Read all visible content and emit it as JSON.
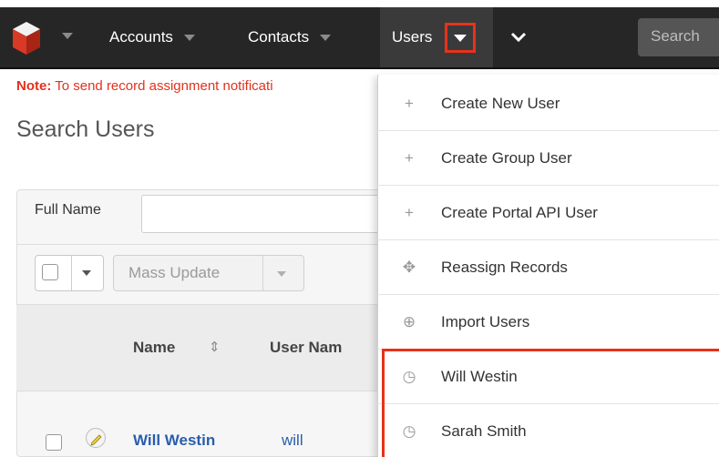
{
  "nav": {
    "items": [
      {
        "label": "Accounts"
      },
      {
        "label": "Contacts"
      },
      {
        "label": "Users"
      }
    ],
    "search_placeholder": "Search"
  },
  "note": {
    "prefix": "Note:",
    "text": "To send record assignment notificati"
  },
  "page": {
    "title": "Search Users"
  },
  "filter": {
    "full_name_label": "Full Name"
  },
  "toolbar": {
    "mass_update_label": "Mass Update"
  },
  "table": {
    "columns": [
      "Name",
      "User Nam"
    ],
    "rows": [
      {
        "name": "Will Westin",
        "user_name": "will"
      }
    ]
  },
  "users_menu": {
    "actions": [
      {
        "label": "Create New User",
        "icon": "plus-icon"
      },
      {
        "label": "Create Group User",
        "icon": "plus-icon"
      },
      {
        "label": "Create Portal API User",
        "icon": "plus-icon"
      },
      {
        "label": "Reassign Records",
        "icon": "move-arrows-icon"
      },
      {
        "label": "Import Users",
        "icon": "import-icon"
      }
    ],
    "recent": [
      {
        "label": "Will Westin",
        "icon": "clock-icon"
      },
      {
        "label": "Sarah Smith",
        "icon": "clock-icon"
      }
    ]
  },
  "colors": {
    "navbar": "#262626",
    "highlight": "#e8321a",
    "note_text": "#e2311d",
    "link": "#2a5dad"
  }
}
